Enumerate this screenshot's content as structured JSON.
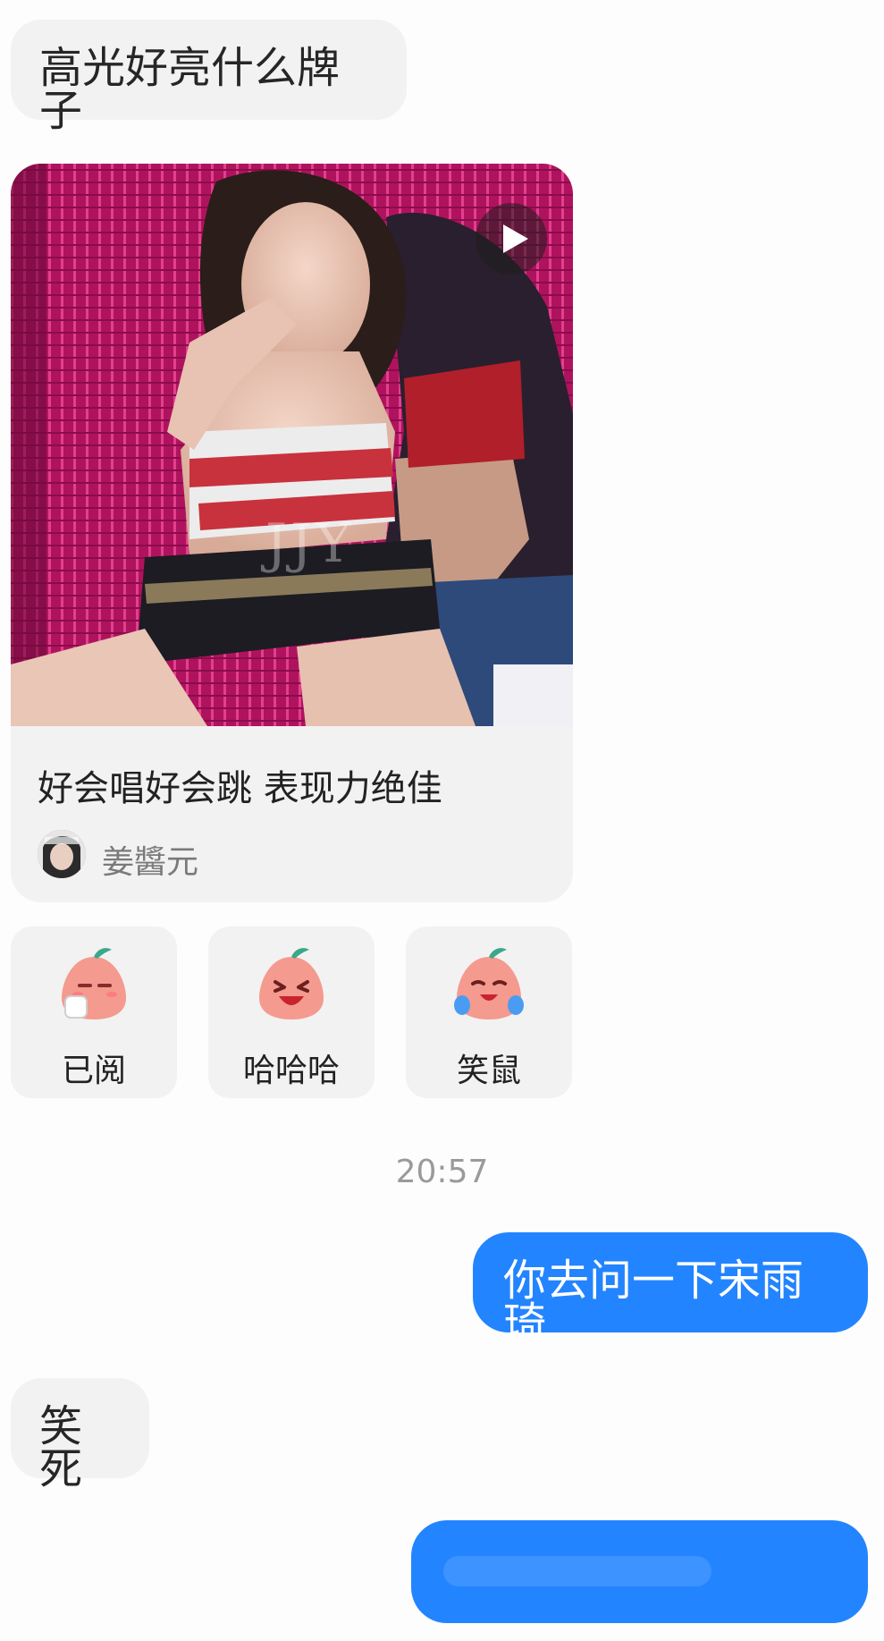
{
  "messages": {
    "m1": "高光好亮什么牌子",
    "card": {
      "title": "好会唱好会跳 表现力绝佳",
      "author": "姜醬元",
      "watermark": "JJY"
    },
    "reactions": [
      {
        "label": "已阅",
        "icon": "peach-tea-icon"
      },
      {
        "label": "哈哈哈",
        "icon": "peach-laughing-icon"
      },
      {
        "label": "笑鼠",
        "icon": "peach-crying-laughing-icon"
      }
    ],
    "timestamp": "20:57",
    "m2": "你去问一下宋雨琦",
    "m3": "笑死"
  },
  "colors": {
    "outgoing_bubble": "#2384ff",
    "incoming_bubble": "#f2f2f2",
    "background": "#fdfdfd"
  }
}
